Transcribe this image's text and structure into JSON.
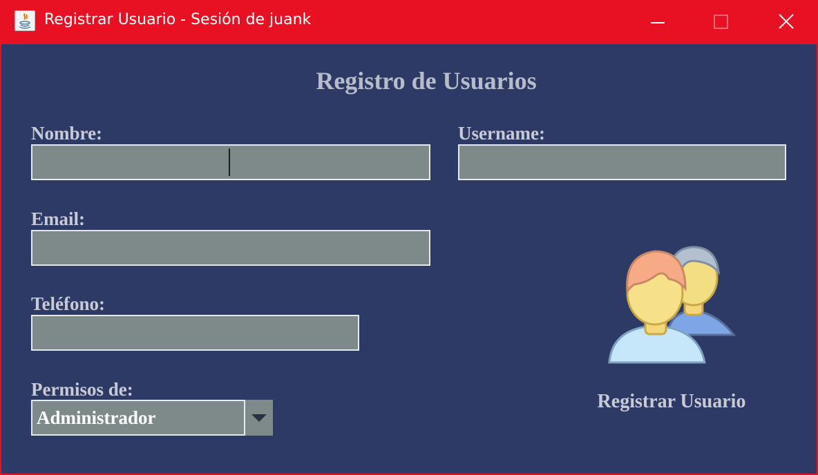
{
  "window": {
    "title": "Registrar Usuario - Sesión de juank",
    "controls": [
      "minimize-icon",
      "maximize-icon",
      "close-icon"
    ],
    "accent_color": "#e81123",
    "background_color": "#2e3a66"
  },
  "form": {
    "heading": "Registro de Usuarios",
    "nombre": {
      "label": "Nombre:",
      "value": ""
    },
    "username": {
      "label": "Username:",
      "value": ""
    },
    "email": {
      "label": "Email:",
      "value": ""
    },
    "telefono": {
      "label": "Teléfono:",
      "value": ""
    },
    "permisos": {
      "label": "Permisos de:",
      "selected": "Administrador"
    }
  },
  "action": {
    "icon": "users-icon",
    "label": "Registrar Usuario"
  }
}
